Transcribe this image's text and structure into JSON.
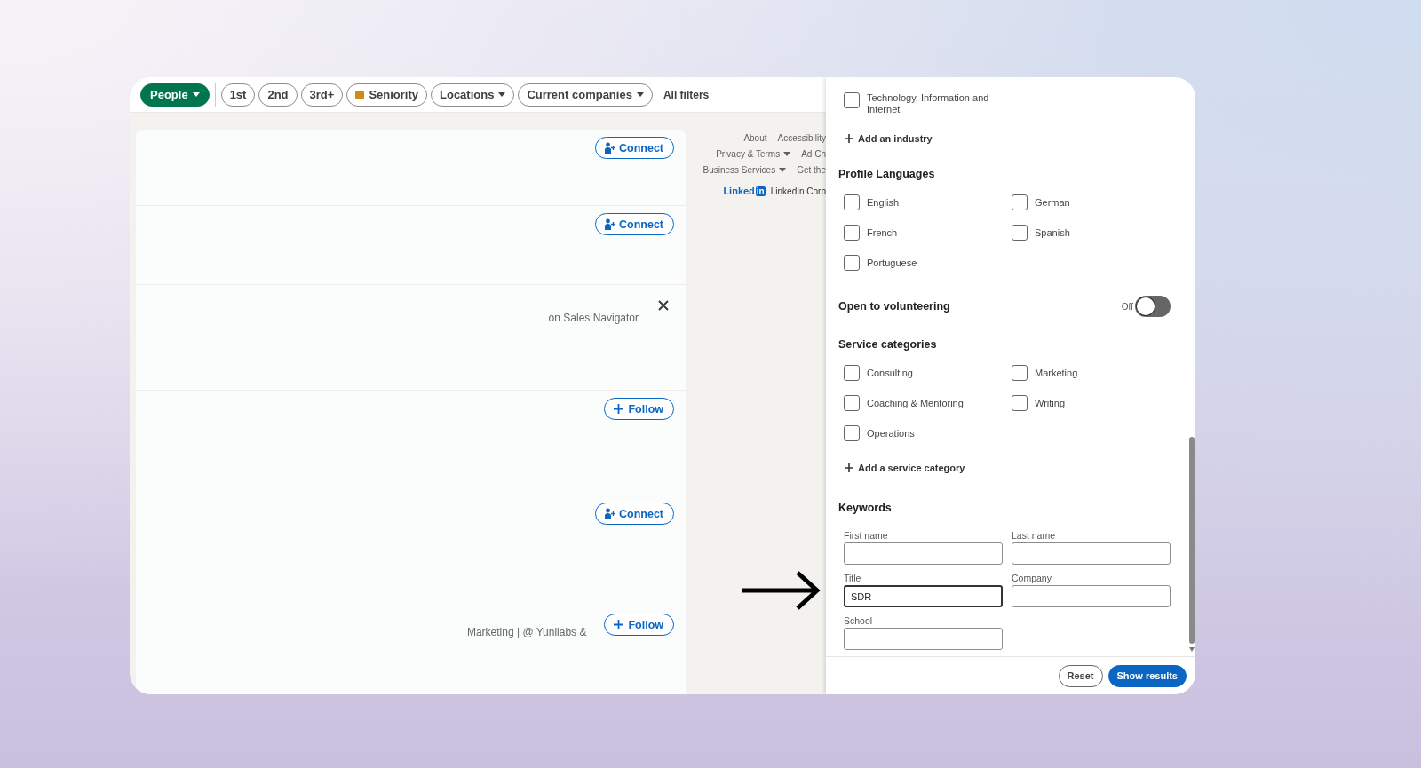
{
  "filter_bar": {
    "pills": [
      {
        "label": "People",
        "kind": "primary",
        "dropdown": true
      },
      {
        "label": "1st",
        "kind": "plain",
        "dropdown": false
      },
      {
        "label": "2nd",
        "kind": "plain",
        "dropdown": false
      },
      {
        "label": "3rd+",
        "kind": "plain",
        "dropdown": false
      },
      {
        "label": "Seniority",
        "kind": "tagged",
        "dropdown": false
      },
      {
        "label": "Locations",
        "kind": "plain",
        "dropdown": true
      },
      {
        "label": "Current companies",
        "kind": "plain",
        "dropdown": true
      }
    ],
    "all_filters": "All filters"
  },
  "results": [
    {
      "dismissible": false,
      "button": {
        "label": "Connect",
        "kind": "connect"
      }
    },
    {
      "dismissible": false,
      "button": {
        "label": "Connect",
        "kind": "connect"
      }
    },
    {
      "dismissible": true,
      "text": "on Sales Navigator"
    },
    {
      "dismissible": false,
      "button": {
        "label": "Follow",
        "kind": "follow"
      }
    },
    {
      "dismissible": false,
      "button": {
        "label": "Connect",
        "kind": "connect"
      }
    },
    {
      "dismissible": false,
      "text": "Marketing | @ Yunilabs &",
      "button": {
        "label": "Follow",
        "kind": "follow"
      }
    }
  ],
  "footer": {
    "lines": [
      [
        {
          "label": "About",
          "dropdown": false
        },
        {
          "label": "Accessibility",
          "dropdown": false
        }
      ],
      [
        {
          "label": "Privacy & Terms",
          "dropdown": true
        },
        {
          "label": "Ad Ch",
          "dropdown": false
        }
      ],
      [
        {
          "label": "Business Services",
          "dropdown": true
        },
        {
          "label": "Get the",
          "dropdown": false
        }
      ]
    ],
    "brand": {
      "logo_word": "Linked",
      "logo_box": "in",
      "text": "LinkedIn Corp"
    }
  },
  "filters": {
    "industries": [
      {
        "label": "Technology, Information and Internet",
        "checked": false
      }
    ],
    "add_industry": "Add an industry",
    "languages": {
      "title": "Profile Languages",
      "options": [
        {
          "label": "English",
          "checked": false
        },
        {
          "label": "German",
          "checked": false
        },
        {
          "label": "French",
          "checked": false
        },
        {
          "label": "Spanish",
          "checked": false
        },
        {
          "label": "Portuguese",
          "checked": false
        }
      ]
    },
    "volunteering": {
      "title": "Open to volunteering",
      "state_label": "Off",
      "on": false
    },
    "service_categories": {
      "title": "Service categories",
      "options": [
        {
          "label": "Consulting",
          "checked": false
        },
        {
          "label": "Marketing",
          "checked": false
        },
        {
          "label": "Coaching & Mentoring",
          "checked": false
        },
        {
          "label": "Writing",
          "checked": false
        },
        {
          "label": "Operations",
          "checked": false
        }
      ],
      "add": "Add a service category"
    },
    "keywords": {
      "title": "Keywords",
      "fields": [
        {
          "label": "First name",
          "focused": false
        },
        {
          "label": "Last name",
          "focused": false
        },
        {
          "label": "Title",
          "value": "SDR",
          "focused": true
        },
        {
          "label": "Company",
          "focused": false
        },
        {
          "label": "School",
          "focused": false
        }
      ]
    },
    "actions": [
      {
        "label": "Reset",
        "kind": "secondary"
      },
      {
        "label": "Show results",
        "kind": "primary"
      }
    ]
  }
}
